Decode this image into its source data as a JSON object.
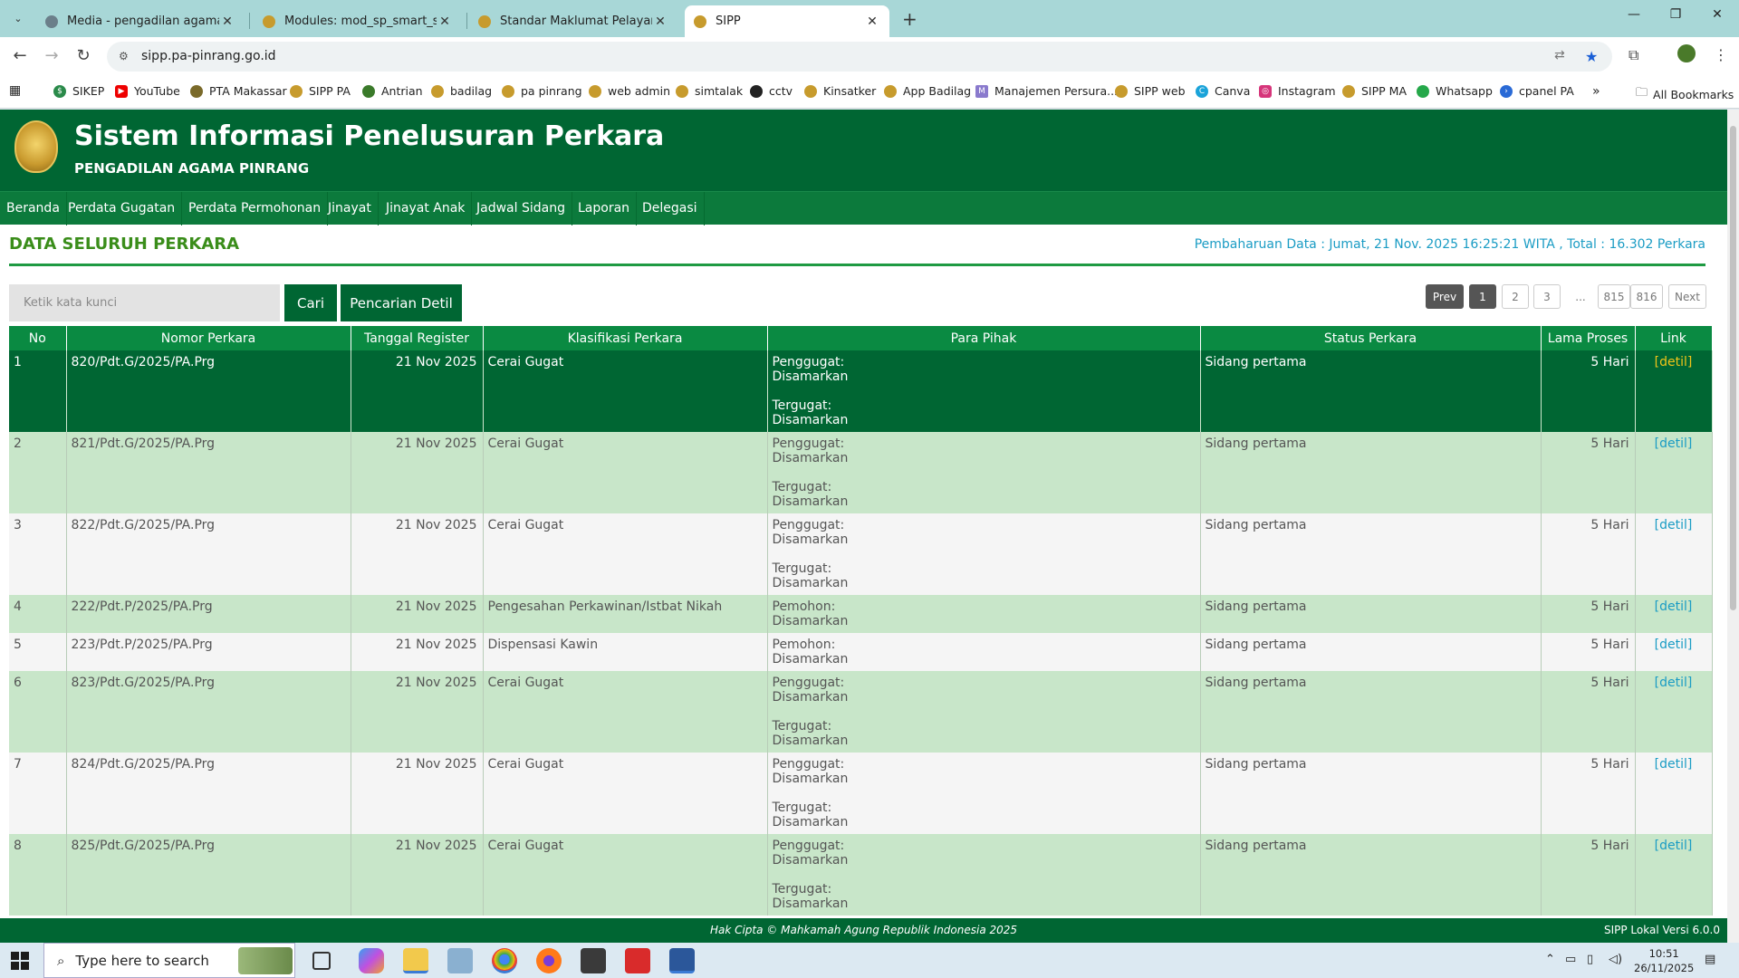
{
  "browser": {
    "tabs": [
      {
        "title": "Media - pengadilan agama pin",
        "active": false
      },
      {
        "title": "Modules: mod_sp_smart_slider",
        "active": false
      },
      {
        "title": "Standar Maklumat Pelayanan",
        "active": false
      },
      {
        "title": "SIPP",
        "active": true
      }
    ],
    "url": "sipp.pa-pinrang.go.id",
    "bookmarks": [
      "SIKEP",
      "YouTube",
      "PTA Makassar",
      "SIPP PA",
      "Antrian",
      "badilag",
      "pa pinrang",
      "web admin",
      "simtalak",
      "cctv",
      "Kinsatker",
      "App Badilag",
      "Manajemen Persura...",
      "SIPP web",
      "Canva",
      "Instagram",
      "SIPP MA",
      "Whatsapp",
      "cpanel PA"
    ],
    "all_bookmarks": "All Bookmarks"
  },
  "site": {
    "title": "Sistem Informasi Penelusuran Perkara",
    "subtitle": "PENGADILAN AGAMA PINRANG",
    "nav": [
      "Beranda",
      "Perdata Gugatan",
      "Perdata Permohonan",
      "Jinayat",
      "Jinayat Anak",
      "Jadwal Sidang",
      "Laporan",
      "Delegasi"
    ]
  },
  "main": {
    "section_title": "DATA SELURUH PERKARA",
    "update_info": "Pembaharuan Data : Jumat, 21 Nov. 2025 16:25:21 WITA , Total : 16.302 Perkara",
    "search_placeholder": "Ketik kata kunci",
    "search_button": "Cari",
    "detail_search_button": "Pencarian Detil",
    "pagination": {
      "prev": "Prev",
      "pages": [
        "1",
        "2",
        "3"
      ],
      "ellipsis": "...",
      "last_pages": [
        "815",
        "816"
      ],
      "next": "Next",
      "current": "1"
    },
    "table": {
      "headers": [
        "No",
        "Nomor Perkara",
        "Tanggal Register",
        "Klasifikasi Perkara",
        "Para Pihak",
        "Status Perkara",
        "Lama Proses",
        "Link"
      ],
      "rows": [
        {
          "no": "1",
          "nomor": "820/Pdt.G/2025/PA.Prg",
          "tanggal": "21 Nov 2025",
          "klasifikasi": "Cerai Gugat",
          "pihak1_label": "Penggugat:",
          "pihak1_value": "Disamarkan",
          "pihak2_label": "Tergugat:",
          "pihak2_value": "Disamarkan",
          "status": "Sidang pertama",
          "lama": "5 Hari",
          "link": "[detil]"
        },
        {
          "no": "2",
          "nomor": "821/Pdt.G/2025/PA.Prg",
          "tanggal": "21 Nov 2025",
          "klasifikasi": "Cerai Gugat",
          "pihak1_label": "Penggugat:",
          "pihak1_value": "Disamarkan",
          "pihak2_label": "Tergugat:",
          "pihak2_value": "Disamarkan",
          "status": "Sidang pertama",
          "lama": "5 Hari",
          "link": "[detil]"
        },
        {
          "no": "3",
          "nomor": "822/Pdt.G/2025/PA.Prg",
          "tanggal": "21 Nov 2025",
          "klasifikasi": "Cerai Gugat",
          "pihak1_label": "Penggugat:",
          "pihak1_value": "Disamarkan",
          "pihak2_label": "Tergugat:",
          "pihak2_value": "Disamarkan",
          "status": "Sidang pertama",
          "lama": "5 Hari",
          "link": "[detil]"
        },
        {
          "no": "4",
          "nomor": "222/Pdt.P/2025/PA.Prg",
          "tanggal": "21 Nov 2025",
          "klasifikasi": "Pengesahan Perkawinan/Istbat Nikah",
          "pihak1_label": "Pemohon:",
          "pihak1_value": "Disamarkan",
          "status": "Sidang pertama",
          "lama": "5 Hari",
          "link": "[detil]"
        },
        {
          "no": "5",
          "nomor": "223/Pdt.P/2025/PA.Prg",
          "tanggal": "21 Nov 2025",
          "klasifikasi": "Dispensasi Kawin",
          "pihak1_label": "Pemohon:",
          "pihak1_value": "Disamarkan",
          "status": "Sidang pertama",
          "lama": "5 Hari",
          "link": "[detil]"
        },
        {
          "no": "6",
          "nomor": "823/Pdt.G/2025/PA.Prg",
          "tanggal": "21 Nov 2025",
          "klasifikasi": "Cerai Gugat",
          "pihak1_label": "Penggugat:",
          "pihak1_value": "Disamarkan",
          "pihak2_label": "Tergugat:",
          "pihak2_value": "Disamarkan",
          "status": "Sidang pertama",
          "lama": "5 Hari",
          "link": "[detil]"
        },
        {
          "no": "7",
          "nomor": "824/Pdt.G/2025/PA.Prg",
          "tanggal": "21 Nov 2025",
          "klasifikasi": "Cerai Gugat",
          "pihak1_label": "Penggugat:",
          "pihak1_value": "Disamarkan",
          "pihak2_label": "Tergugat:",
          "pihak2_value": "Disamarkan",
          "status": "Sidang pertama",
          "lama": "5 Hari",
          "link": "[detil]"
        },
        {
          "no": "8",
          "nomor": "825/Pdt.G/2025/PA.Prg",
          "tanggal": "21 Nov 2025",
          "klasifikasi": "Cerai Gugat",
          "pihak1_label": "Penggugat:",
          "pihak1_value": "Disamarkan",
          "pihak2_label": "Tergugat:",
          "pihak2_value": "Disamarkan",
          "status": "Sidang pertama",
          "lama": "5 Hari",
          "link": "[detil]"
        }
      ]
    }
  },
  "footer": {
    "copyright": "Hak Cipta © Mahkamah Agung Republik Indonesia 2025",
    "version": "SIPP Lokal Versi 6.0.0"
  },
  "taskbar": {
    "search_placeholder": "Type here to search",
    "time": "10:51",
    "date": "26/11/2025"
  },
  "colors": {
    "header_green": "#006633",
    "table_header": "#0a8a42",
    "row_alt": "#c8e6c9",
    "link_blue": "#1a9cc4",
    "title_green": "#3a8d1a"
  }
}
